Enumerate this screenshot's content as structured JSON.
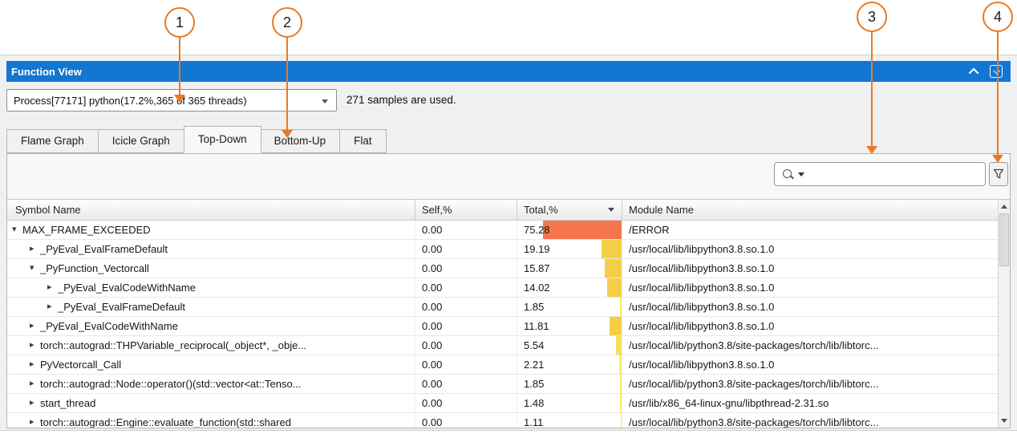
{
  "callouts": [
    "1",
    "2",
    "3",
    "4"
  ],
  "colors": {
    "annotation_orange": "#e97a24",
    "titlebar_blue": "#1277d2",
    "heat_high": "#f5764e",
    "heat_gold": "#f4cf46",
    "heat_mid": "#f7de52",
    "heat_low": "#fbee61"
  },
  "titlebar": {
    "title": "Function View"
  },
  "toolbar": {
    "process_selector_value": "Process[77171] python(17.2%,365 of 365 threads)",
    "samples_note": "271 samples are used."
  },
  "tabs": [
    {
      "label": "Flame Graph",
      "active": false
    },
    {
      "label": "Icicle Graph",
      "active": false
    },
    {
      "label": "Top-Down",
      "active": true
    },
    {
      "label": "Bottom-Up",
      "active": false
    },
    {
      "label": "Flat",
      "active": false
    }
  ],
  "search": {
    "value": "",
    "placeholder": ""
  },
  "table": {
    "columns": [
      {
        "label": "Symbol Name"
      },
      {
        "label": "Self,%"
      },
      {
        "label": "Total,%",
        "sorted": "desc"
      },
      {
        "label": "Module Name"
      }
    ],
    "rows": [
      {
        "level": 0,
        "state": "expanded",
        "symbol": "MAX_FRAME_EXCEEDED",
        "self": "0.00",
        "total": "75.28",
        "bar": "#f5764e",
        "module": "/ERROR"
      },
      {
        "level": 1,
        "state": "collapsed",
        "symbol": "_PyEval_EvalFrameDefault",
        "self": "0.00",
        "total": "19.19",
        "bar": "#f4cf46",
        "module": "/usr/local/lib/libpython3.8.so.1.0"
      },
      {
        "level": 1,
        "state": "expanded",
        "symbol": "_PyFunction_Vectorcall",
        "self": "0.00",
        "total": "15.87",
        "bar": "#f4cf46",
        "module": "/usr/local/lib/libpython3.8.so.1.0"
      },
      {
        "level": 2,
        "state": "collapsed",
        "symbol": "_PyEval_EvalCodeWithName",
        "self": "0.00",
        "total": "14.02",
        "bar": "#f4cf46",
        "module": "/usr/local/lib/libpython3.8.so.1.0"
      },
      {
        "level": 2,
        "state": "collapsed",
        "symbol": "_PyEval_EvalFrameDefault",
        "self": "0.00",
        "total": "1.85",
        "bar": "#fbee61",
        "module": "/usr/local/lib/libpython3.8.so.1.0"
      },
      {
        "level": 1,
        "state": "collapsed",
        "symbol": "_PyEval_EvalCodeWithName",
        "self": "0.00",
        "total": "11.81",
        "bar": "#f4cf46",
        "module": "/usr/local/lib/libpython3.8.so.1.0"
      },
      {
        "level": 1,
        "state": "collapsed",
        "symbol": "torch::autograd::THPVariable_reciprocal(_object*, _obje...",
        "self": "0.00",
        "total": "5.54",
        "bar": "#f7de52",
        "module": "/usr/local/lib/python3.8/site-packages/torch/lib/libtorc..."
      },
      {
        "level": 1,
        "state": "collapsed",
        "symbol": "PyVectorcall_Call",
        "self": "0.00",
        "total": "2.21",
        "bar": "#fbee61",
        "module": "/usr/local/lib/libpython3.8.so.1.0"
      },
      {
        "level": 1,
        "state": "collapsed",
        "symbol": "torch::autograd::Node::operator()(std::vector<at::Tenso...",
        "self": "0.00",
        "total": "1.85",
        "bar": "#fbee61",
        "module": "/usr/local/lib/python3.8/site-packages/torch/lib/libtorc..."
      },
      {
        "level": 1,
        "state": "collapsed",
        "symbol": "start_thread",
        "self": "0.00",
        "total": "1.48",
        "bar": "#fbee61",
        "module": "/usr/lib/x86_64-linux-gnu/libpthread-2.31.so"
      },
      {
        "level": 1,
        "state": "collapsed",
        "symbol": "torch::autograd::Engine::evaluate_function(std::shared",
        "self": "0.00",
        "total": "1.11",
        "bar": "#fbee61",
        "module": "/usr/local/lib/python3.8/site-packages/torch/lib/libtorc..."
      }
    ]
  }
}
